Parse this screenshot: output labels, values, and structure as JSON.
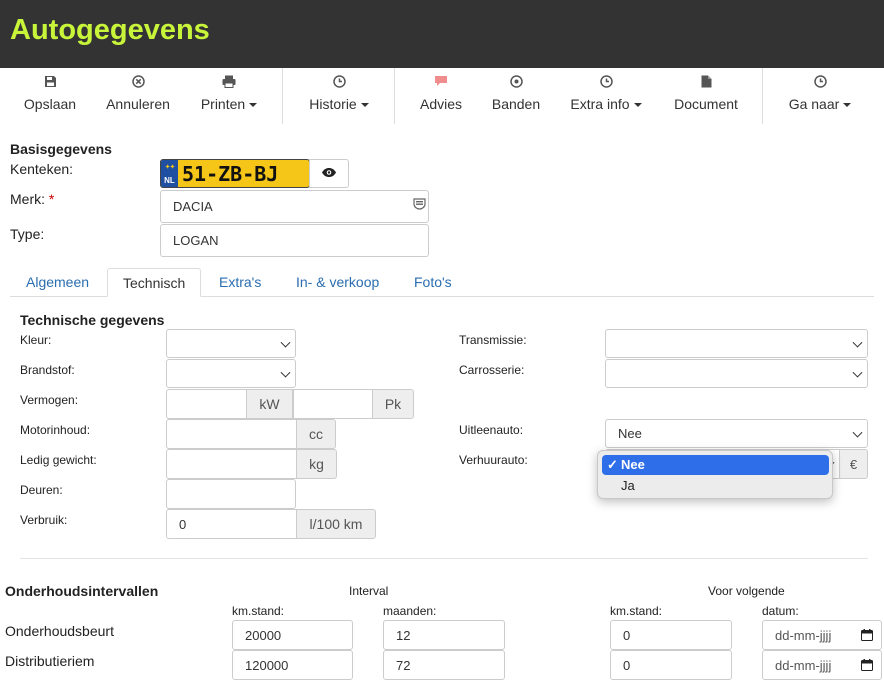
{
  "header": {
    "title": "Autogegevens"
  },
  "toolbar": {
    "save": "Opslaan",
    "cancel": "Annuleren",
    "print": "Printen",
    "history": "Historie",
    "advice": "Advies",
    "tyres": "Banden",
    "extra_info": "Extra info",
    "document": "Document",
    "goto": "Ga naar"
  },
  "basis": {
    "heading": "Basisgegevens",
    "kenteken_label": "Kenteken:",
    "plate_country": "NL",
    "plate": "51-ZB-BJ",
    "merk_label": "Merk:",
    "merk_required": "*",
    "merk_value": "DACIA",
    "type_label": "Type:",
    "type_value": "LOGAN"
  },
  "tabs": [
    "Algemeen",
    "Technisch",
    "Extra's",
    "In- & verkoop",
    "Foto's"
  ],
  "active_tab": "Technisch",
  "technisch": {
    "heading": "Technische gegevens",
    "kleur": "Kleur:",
    "brandstof": "Brandstof:",
    "vermogen": "Vermogen:",
    "kw_unit": "kW",
    "pk_unit": "Pk",
    "motorinhoud": "Motorinhoud:",
    "cc_unit": "cc",
    "ledig_gewicht": "Ledig gewicht:",
    "kg_unit": "kg",
    "deuren": "Deuren:",
    "verbruik": "Verbruik:",
    "verbruik_value": "0",
    "verbruik_unit": "l/100 km",
    "transmissie": "Transmissie:",
    "carrosserie": "Carrosserie:",
    "uitleenauto": "Uitleenauto:",
    "uitleenauto_value": "Nee",
    "verhuurauto": "Verhuurauto:",
    "euro_unit": "€"
  },
  "dropdown": {
    "options": [
      "Nee",
      "Ja"
    ],
    "selected": "Nee",
    "check": "✓"
  },
  "onderhoud": {
    "heading": "Onderhoudsintervallen",
    "interval": "Interval",
    "voor_volgende": "Voor volgende",
    "km_stand": "km.stand:",
    "maanden": "maanden:",
    "km_stand2": "km.stand:",
    "datum": "datum:",
    "rows": [
      {
        "label": "Onderhoudsbeurt",
        "km": "20000",
        "maanden": "12",
        "next_km": "0",
        "date_placeholder": "dd-mm-jjjj"
      },
      {
        "label": "Distributieriem",
        "km": "120000",
        "maanden": "72",
        "next_km": "0",
        "date_placeholder": "dd-mm-jjjj"
      }
    ]
  },
  "colors": {
    "title": "#c8f53a",
    "topbar": "#333333",
    "link": "#2a6db0",
    "selected_option": "#2e6ee8",
    "plate": "#f5c518"
  }
}
